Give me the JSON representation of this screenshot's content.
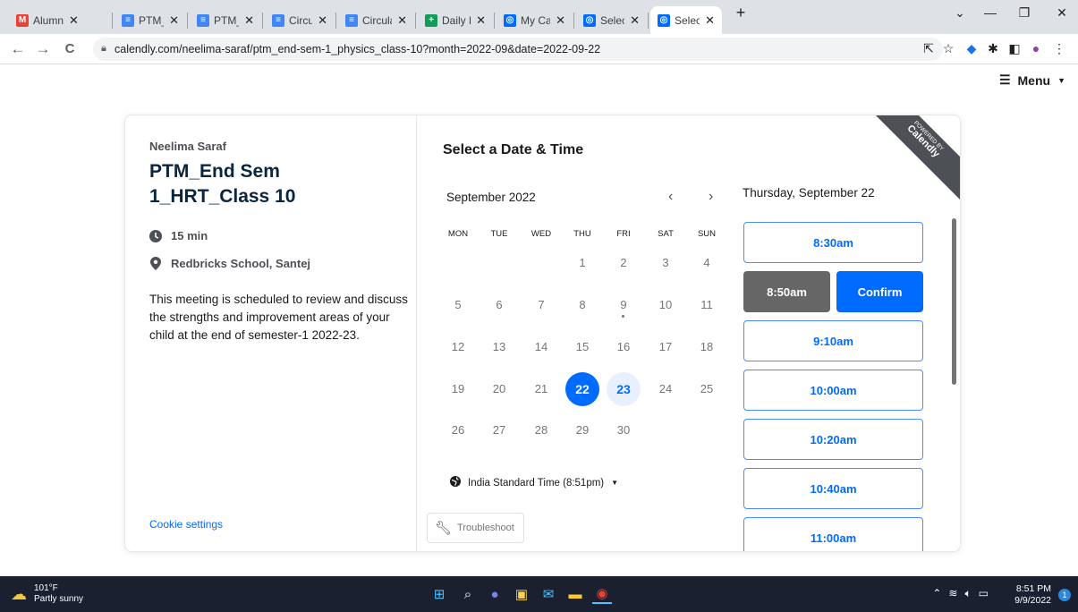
{
  "browser": {
    "tabs": [
      {
        "title": "Alumni co",
        "icon": "gmail-icon",
        "color": "#ea4335",
        "glyph": "M"
      },
      {
        "title": "PTM_End",
        "icon": "docs-icon",
        "color": "#4285f4",
        "glyph": "≡"
      },
      {
        "title": "PTM_End",
        "icon": "docs-icon",
        "color": "#4285f4",
        "glyph": "≡"
      },
      {
        "title": "Circular_Re",
        "icon": "docs-icon",
        "color": "#4285f4",
        "glyph": "≡"
      },
      {
        "title": "Circular no",
        "icon": "docs-icon",
        "color": "#4285f4",
        "glyph": "≡"
      },
      {
        "title": "Daily Repo",
        "icon": "sheets-icon",
        "color": "#0f9d58",
        "glyph": "+"
      },
      {
        "title": "My Calend",
        "icon": "calendly-icon",
        "color": "#006bff",
        "glyph": "◎"
      },
      {
        "title": "Select a Da",
        "icon": "calendly-icon",
        "color": "#006bff",
        "glyph": "◎"
      },
      {
        "title": "Select a Da",
        "icon": "calendly-icon",
        "color": "#006bff",
        "glyph": "◎"
      }
    ],
    "url": "calendly.com/neelima-saraf/ptm_end-sem-1_physics_class-10?month=2022-09&date=2022-09-22"
  },
  "header": {
    "menu_label": "Menu"
  },
  "event": {
    "owner": "Neelima Saraf",
    "title": "PTM_End Sem 1_HRT_Class 10",
    "duration": "15 min",
    "location": "Redbricks School, Santej",
    "description": "This meeting is scheduled to review and discuss the strengths and improvement areas of your child at the end of semester-1 2022-23.",
    "cookie_settings": "Cookie settings"
  },
  "calendar": {
    "heading": "Select a Date & Time",
    "month": "September 2022",
    "weekdays": [
      "MON",
      "TUE",
      "WED",
      "THU",
      "FRI",
      "SAT",
      "SUN"
    ],
    "days": [
      [
        "",
        "",
        "",
        "1",
        "2",
        "3",
        "4"
      ],
      [
        "5",
        "6",
        "7",
        "8",
        "9",
        "10",
        "11"
      ],
      [
        "12",
        "13",
        "14",
        "15",
        "16",
        "17",
        "18"
      ],
      [
        "19",
        "20",
        "21",
        "22",
        "23",
        "24",
        "25"
      ],
      [
        "26",
        "27",
        "28",
        "29",
        "30",
        "",
        ""
      ]
    ],
    "selected_day": "22",
    "available_days": [
      "23"
    ],
    "today_day": "9",
    "timezone": "India Standard Time (8:51pm)",
    "troubleshoot": "Troubleshoot"
  },
  "times": {
    "date_header": "Thursday, September 22",
    "slots": [
      "8:30am",
      "8:50am",
      "9:10am",
      "10:00am",
      "10:20am",
      "10:40am",
      "11:00am"
    ],
    "selected_slot": "8:50am",
    "confirm_label": "Confirm"
  },
  "badge": {
    "line1": "POWERED BY",
    "line2": "Calendly"
  },
  "taskbar": {
    "temperature": "101°F",
    "weather": "Partly sunny",
    "time": "8:51 PM",
    "date": "9/9/2022",
    "notifications": "1"
  }
}
